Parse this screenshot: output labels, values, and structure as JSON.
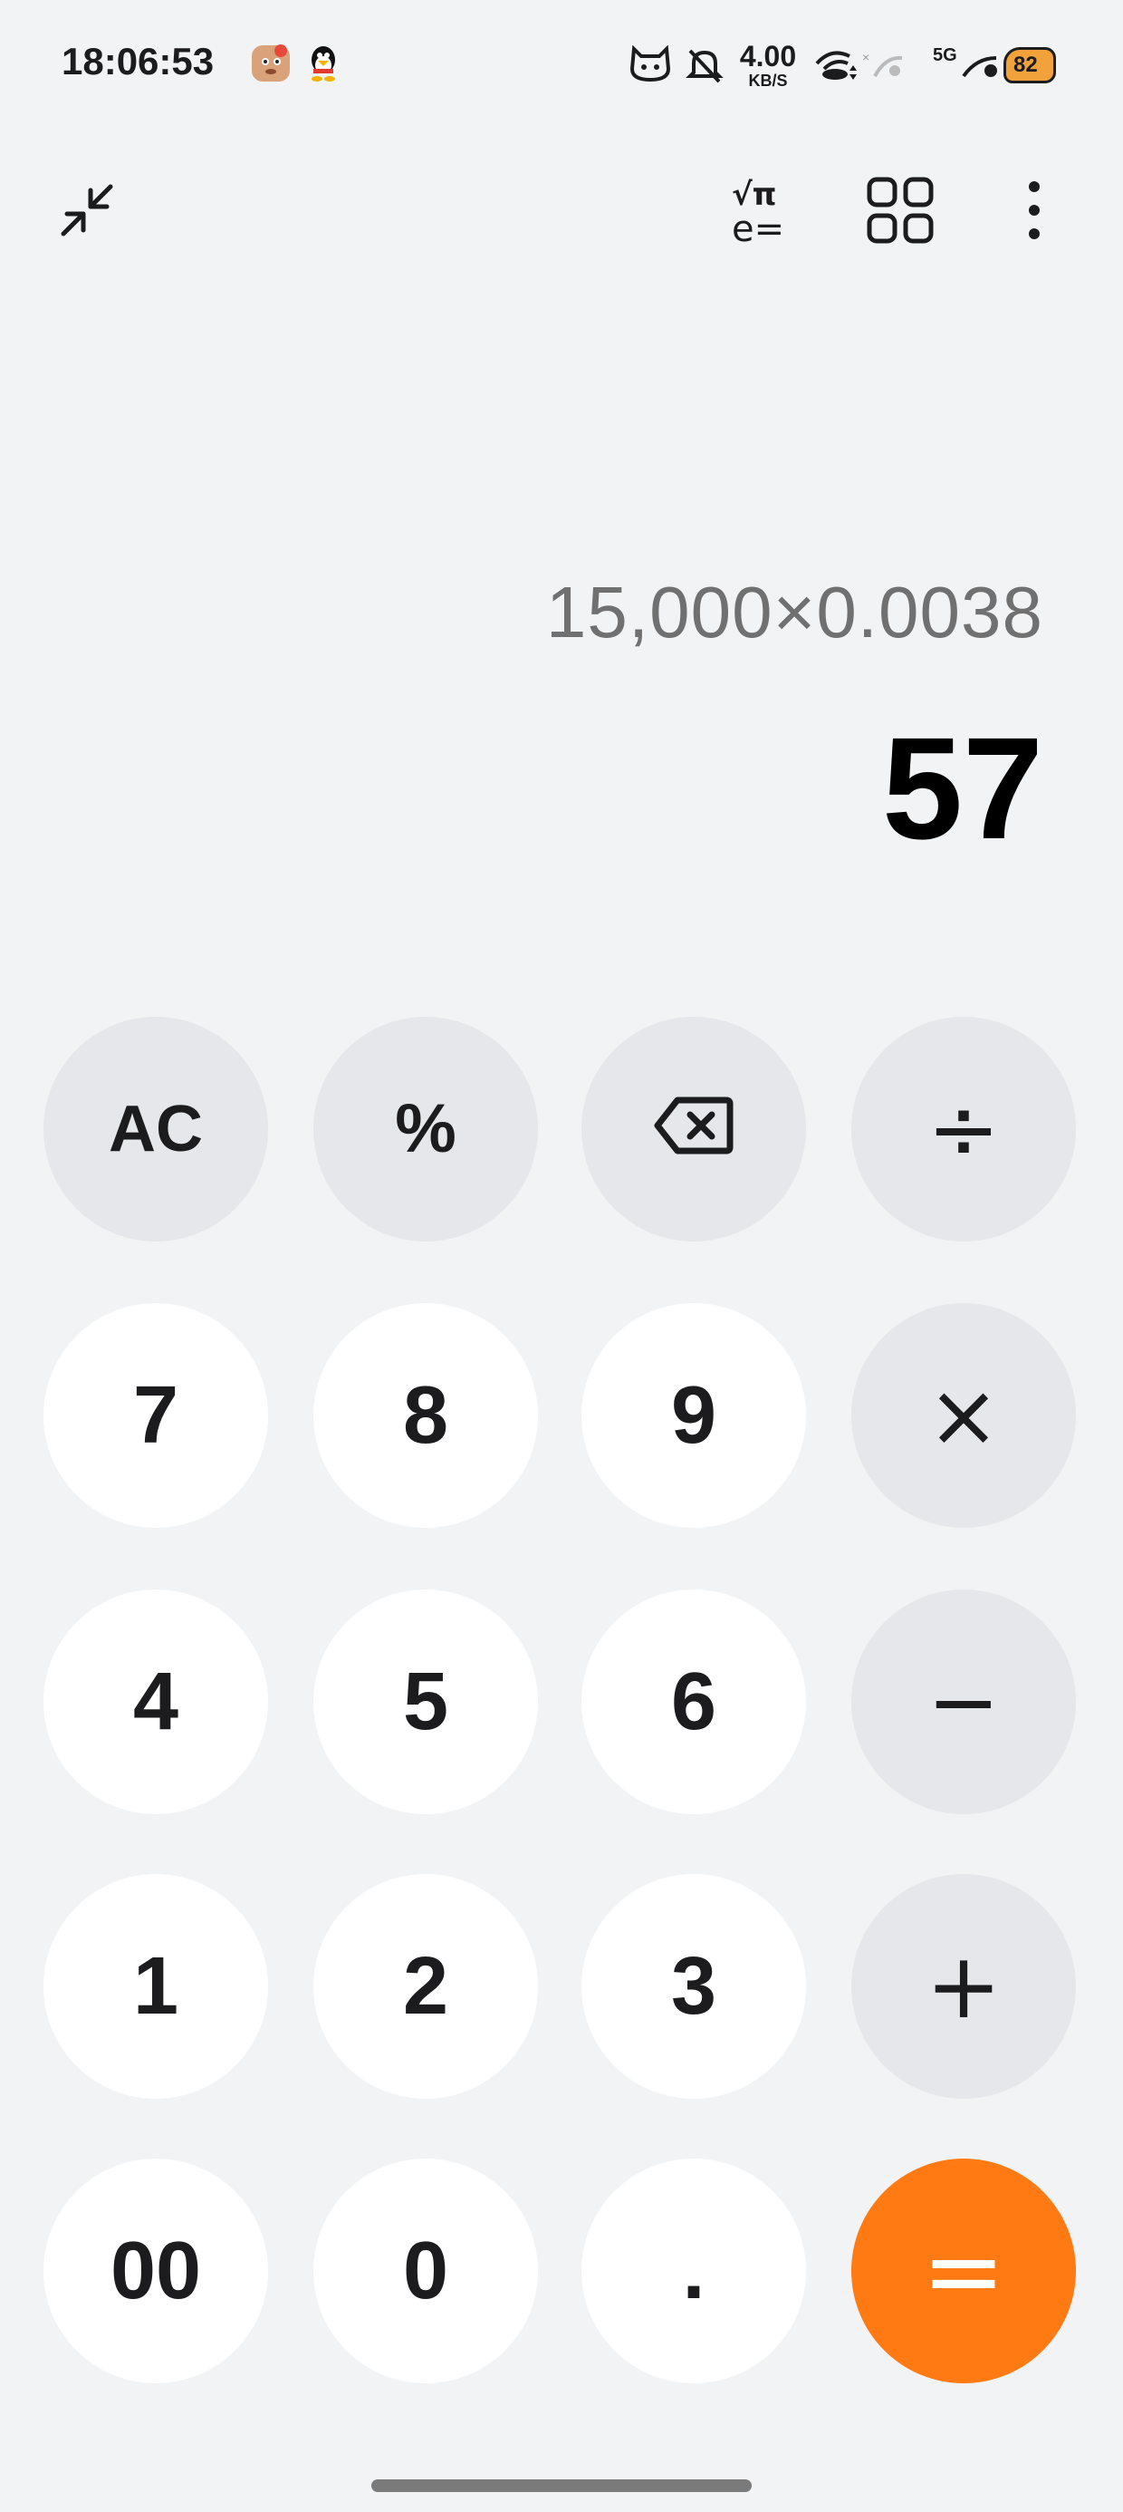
{
  "status_bar": {
    "time": "18:06:53",
    "net_speed_value": "4.00",
    "net_speed_unit": "KB/S",
    "network": "5G",
    "battery": "82",
    "icons": [
      "cartoon-app-icon",
      "qq-penguin-icon",
      "cat-face-icon",
      "mute-icon",
      "wifi-icon",
      "signal-icon",
      "battery-icon"
    ]
  },
  "toolbar": {
    "icons": [
      "collapse-icon",
      "scientific-mode-icon",
      "converter-grid-icon",
      "more-options-icon"
    ]
  },
  "display": {
    "expression": "15,000×0.0038",
    "result": "57"
  },
  "keypad": {
    "row1": [
      "AC",
      "%",
      "⌫",
      "÷"
    ],
    "row2": [
      "7",
      "8",
      "9",
      "×"
    ],
    "row3": [
      "4",
      "5",
      "6",
      "−"
    ],
    "row4": [
      "1",
      "2",
      "3",
      "+"
    ],
    "row5": [
      "00",
      "0",
      ".",
      "="
    ]
  },
  "colors": {
    "background": "#f2f3f5",
    "number_key": "#ffffff",
    "operator_key": "#e6e7ea",
    "equals_key": "#ff7a12",
    "expression_text": "#707070",
    "result_text": "#000000"
  }
}
